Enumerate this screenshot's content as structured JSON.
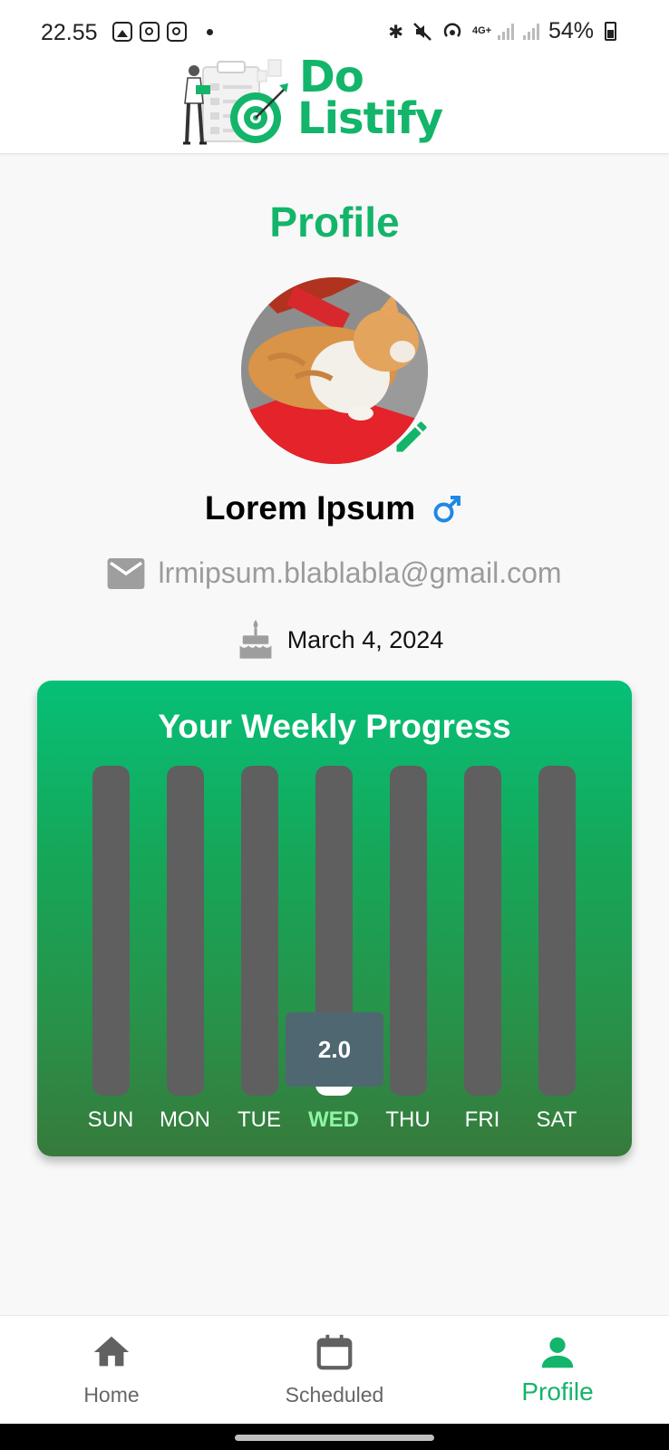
{
  "status_bar": {
    "time": "22.55",
    "network": "4G+",
    "battery": "54%"
  },
  "app": {
    "logo_line1": "Do",
    "logo_line2": "Listify"
  },
  "profile": {
    "title": "Profile",
    "name": "Lorem Ipsum",
    "gender_icon": "male-icon",
    "email": "lrmipsum.blablabla@gmail.com",
    "birthdate": "March 4, 2024"
  },
  "weekly_progress": {
    "title": "Your Weekly Progress",
    "tooltip_value": "2.0",
    "days": [
      {
        "label": "SUN",
        "value": 0,
        "active": false
      },
      {
        "label": "MON",
        "value": 0,
        "active": false
      },
      {
        "label": "TUE",
        "value": 0,
        "active": false
      },
      {
        "label": "WED",
        "value": 2.0,
        "active": true
      },
      {
        "label": "THU",
        "value": 0,
        "active": false
      },
      {
        "label": "FRI",
        "value": 0,
        "active": false
      },
      {
        "label": "SAT",
        "value": 0,
        "active": false
      }
    ],
    "max_value": 10,
    "colors": {
      "gradient_top": "#06c077",
      "gradient_bottom": "#377a3c",
      "track": "#5f5f5f",
      "active_label": "#8df5a3"
    }
  },
  "nav": {
    "items": [
      {
        "label": "Home",
        "icon": "home-icon",
        "active": false
      },
      {
        "label": "Scheduled",
        "icon": "calendar-icon",
        "active": false
      },
      {
        "label": "Profile",
        "icon": "person-icon",
        "active": true
      }
    ]
  },
  "colors": {
    "accent": "#13b56a",
    "muted_text": "#9b9b9b"
  }
}
